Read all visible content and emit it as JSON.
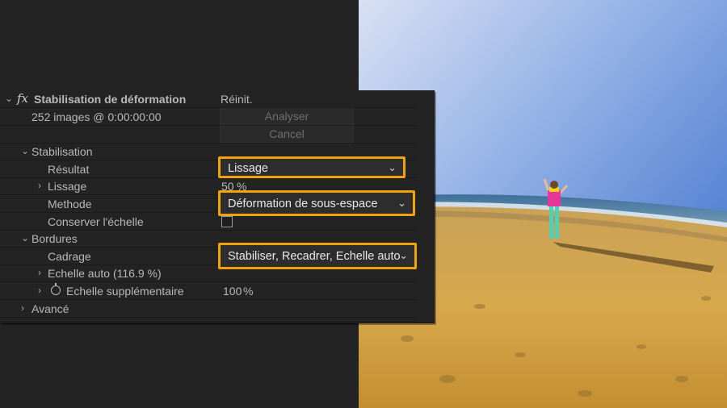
{
  "effect": {
    "title": "Stabilisation de déformation",
    "reset_label": "Réinit.",
    "frames_info": "252 images @ 0:00:00:00",
    "analyze_label": "Analyser",
    "cancel_label": "Cancel"
  },
  "stabilisation": {
    "label": "Stabilisation",
    "result": {
      "label": "Résultat",
      "value": "Lissage"
    },
    "smoothness": {
      "label": "Lissage",
      "value": "50",
      "unit": "%"
    },
    "method": {
      "label": "Methode",
      "value": "Déformation de sous-espace"
    },
    "preserve_scale": {
      "label": "Conserver l'échelle",
      "checked": false
    }
  },
  "borders": {
    "label": "Bordures",
    "framing": {
      "label": "Cadrage",
      "value": "Stabiliser, Recadrer, Echelle auto"
    },
    "auto_scale": {
      "label": "Echelle auto (116.9 %)"
    },
    "additional_scale": {
      "label": "Echelle supplémentaire",
      "value": "100",
      "unit": "%"
    }
  },
  "advanced": {
    "label": "Avancé"
  },
  "icons": {
    "collapse": "chevron-down-icon",
    "expand": "chevron-right-icon",
    "dropdown": "caret-down-icon",
    "stopwatch": "stopwatch-icon",
    "fx": "fx-icon"
  },
  "colors": {
    "panel_bg": "#232323",
    "highlight": "#f2a20c",
    "link": "#3f9bee"
  }
}
